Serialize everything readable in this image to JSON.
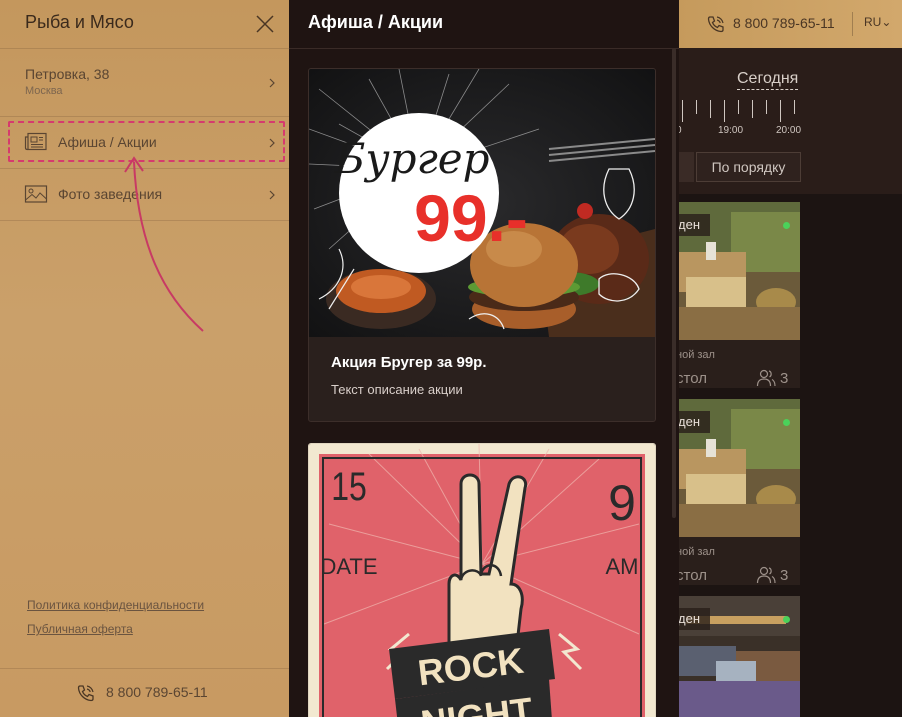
{
  "background_app": {
    "phone": "8 800 789-65-11",
    "language": "RU",
    "today_label": "Сегодня",
    "times": [
      "0",
      "19:00",
      "20:00"
    ],
    "sort_label": "По порядку",
    "cards": [
      {
        "badge": "ден",
        "hall": "ной зал",
        "type": "стол",
        "seats": "3",
        "status_color": "#4bd15a"
      },
      {
        "badge": "ден",
        "hall": "ной зал",
        "type": "стол",
        "seats": "3",
        "status_color": "#4bd15a"
      },
      {
        "badge": "ден",
        "status_color": "#4bd15a"
      }
    ]
  },
  "sidebar": {
    "title": "Рыба и Мясо",
    "address": {
      "street": "Петровка, 38",
      "city": "Москва"
    },
    "items": [
      {
        "label": "Афиша / Акции",
        "icon": "newspaper-icon"
      },
      {
        "label": "Фото заведения",
        "icon": "photo-icon"
      }
    ],
    "links": [
      "Политика конфиденциальности",
      "Публичная оферта"
    ],
    "footer_phone": "8 800 789-65-11"
  },
  "panel": {
    "title": "Афиша / Акции",
    "promos": [
      {
        "title": "Акция Бругер за 99р.",
        "description": "Текст описание акции",
        "image_text_script": "Бургер",
        "image_text_price": "99.-"
      },
      {
        "image_text_left_num": "15",
        "image_text_left_word": "DATE",
        "image_text_right_num": "9",
        "image_text_right_word": "AM",
        "image_text_line1": "ROCK",
        "image_text_line2": "NIGHT"
      }
    ]
  },
  "colors": {
    "sidebar_bg": "#c79c63",
    "panel_bg": "#1f1412",
    "highlight": "#d63a6e",
    "poster_bg": "#e0626a"
  }
}
